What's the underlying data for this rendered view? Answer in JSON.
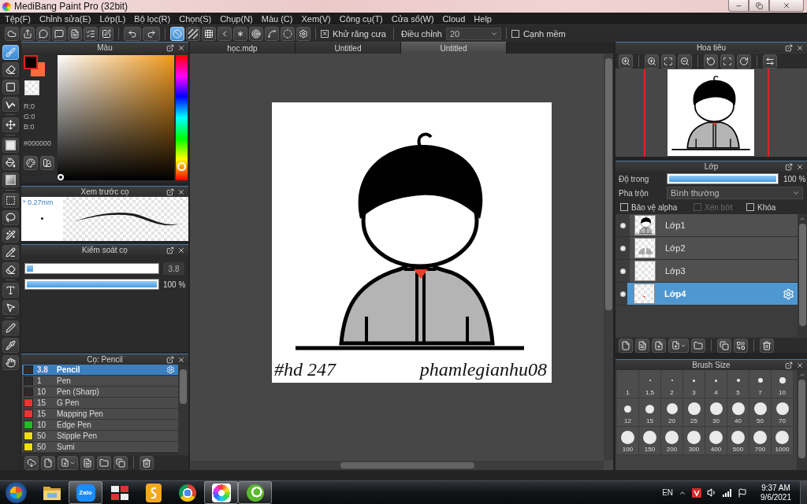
{
  "window": {
    "title": "MediBang Paint Pro (32bit)"
  },
  "menu": [
    "Tệp(F)",
    "Chỉnh sửa(E)",
    "Lớp(L)",
    "Bộ lọc(R)",
    "Chọn(S)",
    "Chụp(N)",
    "Màu (C)",
    "Xem(V)",
    "Công cụ(T)",
    "Cửa sổ(W)",
    "Cloud",
    "Help"
  ],
  "toolbar": {
    "snap_modes": [
      {
        "selected": true
      },
      {
        "selected": false
      },
      {
        "selected": false
      },
      {
        "selected": false
      },
      {
        "selected": false
      },
      {
        "selected": false
      },
      {
        "selected": false
      },
      {
        "selected": false
      }
    ],
    "antialias": {
      "label": "Khử răng cưa",
      "checked": true
    },
    "correction": {
      "label": "Điều chỉnh",
      "value": "20"
    },
    "soft_edge": {
      "label": "Cạnh mềm",
      "checked": false
    }
  },
  "tools": [
    {
      "selected": true
    },
    {
      "selected": false
    },
    {
      "selected": false
    },
    {
      "selected": false
    },
    {
      "selected": false
    },
    {
      "selected": false
    },
    {
      "selected": false
    },
    {
      "selected": false
    },
    {
      "selected": false
    },
    {
      "selected": false
    },
    {
      "selected": false
    },
    {
      "selected": false
    },
    {
      "selected": false
    },
    {
      "selected": false
    },
    {
      "selected": false
    },
    {
      "selected": false
    },
    {
      "selected": false
    },
    {
      "selected": false
    }
  ],
  "color_panel": {
    "title": "Màu",
    "swatches": [
      {
        "kind": "background",
        "color": "#ff6a3d"
      },
      {
        "kind": "foreground",
        "color": "#000000"
      },
      {
        "kind": "transparent"
      }
    ],
    "readout": [
      "R:0",
      "G:0",
      "B:0"
    ],
    "hex": "#000000",
    "hue": {
      "level": 0.08
    }
  },
  "brush_preview": {
    "title": "Xem trước cọ",
    "size": "* 0.27mm"
  },
  "brush_control": {
    "title": "Kiểm soát cọ",
    "sliders": [
      {
        "kind": "size",
        "level": 0.05,
        "reading": "3.8"
      },
      {
        "kind": "opacity",
        "level": 1,
        "reading": "100 %"
      }
    ]
  },
  "brush_list": {
    "title": "Cọ: Pencil",
    "items": [
      {
        "color": "#2b2b2b",
        "size": "3.8",
        "name": "Pencil",
        "selected": true
      },
      {
        "color": "#2b2b2b",
        "size": "1",
        "name": "Pen",
        "selected": false
      },
      {
        "color": "#2b2b2b",
        "size": "10",
        "name": "Pen (Sharp)",
        "selected": false
      },
      {
        "color": "#ee3333",
        "size": "15",
        "name": "G Pen",
        "selected": false
      },
      {
        "color": "#ee3333",
        "size": "15",
        "name": "Mapping Pen",
        "selected": false
      },
      {
        "color": "#22bb22",
        "size": "10",
        "name": "Edge Pen",
        "selected": false
      },
      {
        "color": "#eedd11",
        "size": "50",
        "name": "Stipple Pen",
        "selected": false
      },
      {
        "color": "#eedd11",
        "size": "50",
        "name": "Sumi",
        "selected": false
      }
    ]
  },
  "documents": {
    "tabs": [
      {
        "label": "học.mdp",
        "selected": false
      },
      {
        "label": "Untitled",
        "selected": false
      },
      {
        "label": "Untitled",
        "selected": true
      }
    ],
    "canvas": {
      "signatures": [
        "#hd 247",
        "phamlegianhu08"
      ]
    }
  },
  "navigator": {
    "title": "Hoa tiêu"
  },
  "layers": {
    "title": "Lớp",
    "opacity": {
      "label": "Độ trong",
      "level": 1,
      "reading": "100 %"
    },
    "blend": {
      "label": "Pha trộn",
      "value": "Bình thường"
    },
    "options": [
      {
        "label": "Bảo vệ alpha",
        "checked": false,
        "disabled": false
      },
      {
        "label": "Xén bớt",
        "checked": false,
        "disabled": true
      },
      {
        "label": "Khóa",
        "checked": false,
        "disabled": false
      }
    ],
    "items": [
      {
        "name": "Lớp1",
        "kind": "figure",
        "visible": true,
        "selected": false
      },
      {
        "name": "Lớp2",
        "kind": "shapes",
        "visible": true,
        "selected": false
      },
      {
        "name": "Lớp3",
        "kind": "blank",
        "visible": true,
        "selected": false
      },
      {
        "name": "Lớp4",
        "kind": "mark",
        "visible": true,
        "selected": true
      }
    ]
  },
  "brush_sizes": {
    "title": "Brush Size",
    "sizes": [
      "1",
      "1.5",
      "2",
      "3",
      "4",
      "5",
      "7",
      "10",
      "12",
      "15",
      "20",
      "25",
      "30",
      "40",
      "50",
      "70",
      "100",
      "150",
      "200",
      "300",
      "400",
      "500",
      "700",
      "1000"
    ]
  },
  "taskbar": {
    "apps": [
      {
        "running": false
      },
      {
        "running": true,
        "label": "Zalo"
      },
      {
        "running": false
      },
      {
        "running": false
      },
      {
        "running": false
      },
      {
        "running": true
      },
      {
        "running": true
      }
    ],
    "tray": {
      "language": "EN",
      "time": "9:37 AM",
      "date": "9/6/2021"
    }
  }
}
